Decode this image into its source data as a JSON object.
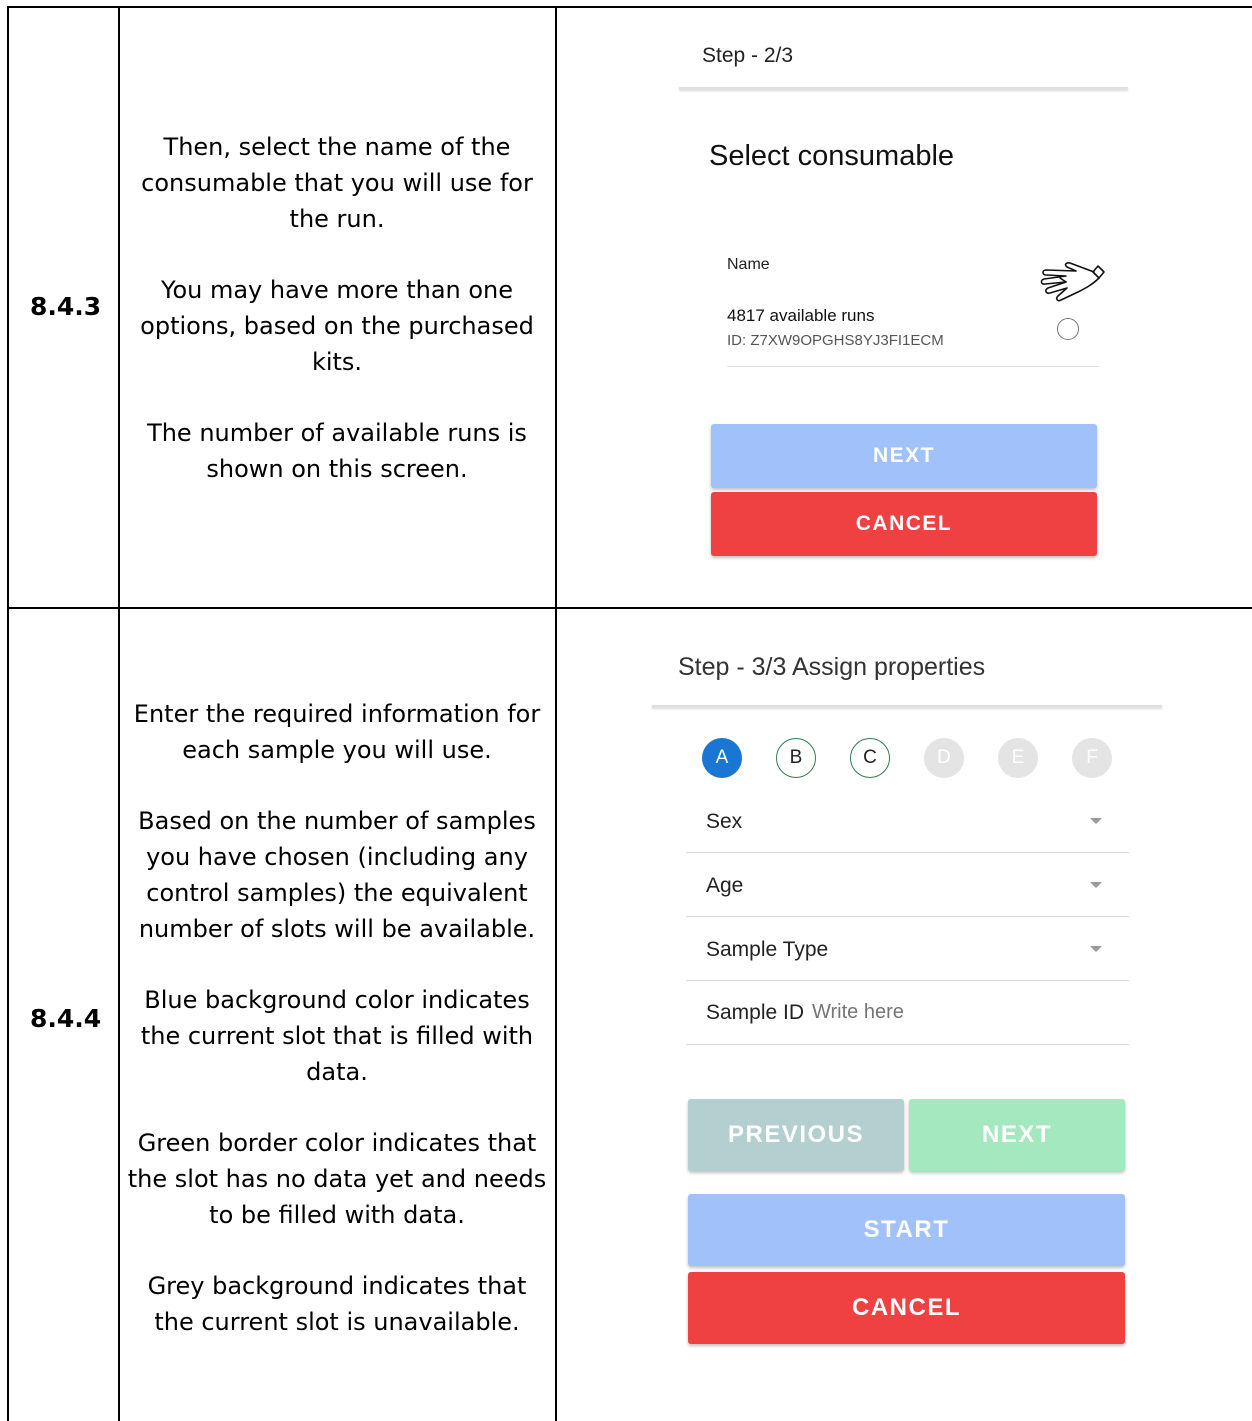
{
  "rows": [
    {
      "step": "8.4.3",
      "description": [
        "Then, select the name of the consumable that you will use for the run.",
        "You may have more than one options, based on the purchased kits.",
        "The number of available runs is shown on this screen."
      ],
      "screen": {
        "step_title": "Step - 2/3",
        "heading": "Select consumable",
        "list_header": "Name",
        "item_title": "4817 available runs",
        "item_id": "ID: Z7XW9OPGHS8YJ3FI1ECM",
        "next_label": "NEXT",
        "cancel_label": "CANCEL"
      }
    },
    {
      "step": "8.4.4",
      "description": [
        "Enter the required information for  each sample you will use.",
        "Based on the number of samples you have chosen (including any control samples) the equivalent number of slots will be available.",
        "Blue background color indicates the current slot that is filled with data.",
        "Green border color indicates that the slot has no data yet and needs to be filled with data.",
        "Grey background indicates that the current slot is unavailable."
      ],
      "screen": {
        "step_title": "Step - 3/3 Assign properties",
        "slots": [
          {
            "label": "A",
            "state": "current"
          },
          {
            "label": "B",
            "state": "empty"
          },
          {
            "label": "C",
            "state": "empty"
          },
          {
            "label": "D",
            "state": "unavailable"
          },
          {
            "label": "E",
            "state": "unavailable"
          },
          {
            "label": "F",
            "state": "unavailable"
          }
        ],
        "fields": {
          "sex": "Sex",
          "age": "Age",
          "sample_type": "Sample Type",
          "sample_id": "Sample ID",
          "sample_id_placeholder": "Write here"
        },
        "previous_label": "PREVIOUS",
        "next_label": "NEXT",
        "start_label": "START",
        "cancel_label": "CANCEL"
      }
    }
  ],
  "colors": {
    "next_blue": "#a0c1fa",
    "cancel_red": "#ef4141",
    "previous_grey": "#b3cfcf",
    "next_green": "#a4e8c0",
    "slot_current": "#1976d2",
    "slot_empty_border": "#2e7d4f",
    "slot_unavailable": "#e4e4e4"
  },
  "icons": {
    "pointer": "pointing-hand-icon",
    "radio": "radio-button-icon",
    "dropdown": "dropdown-caret-icon"
  }
}
